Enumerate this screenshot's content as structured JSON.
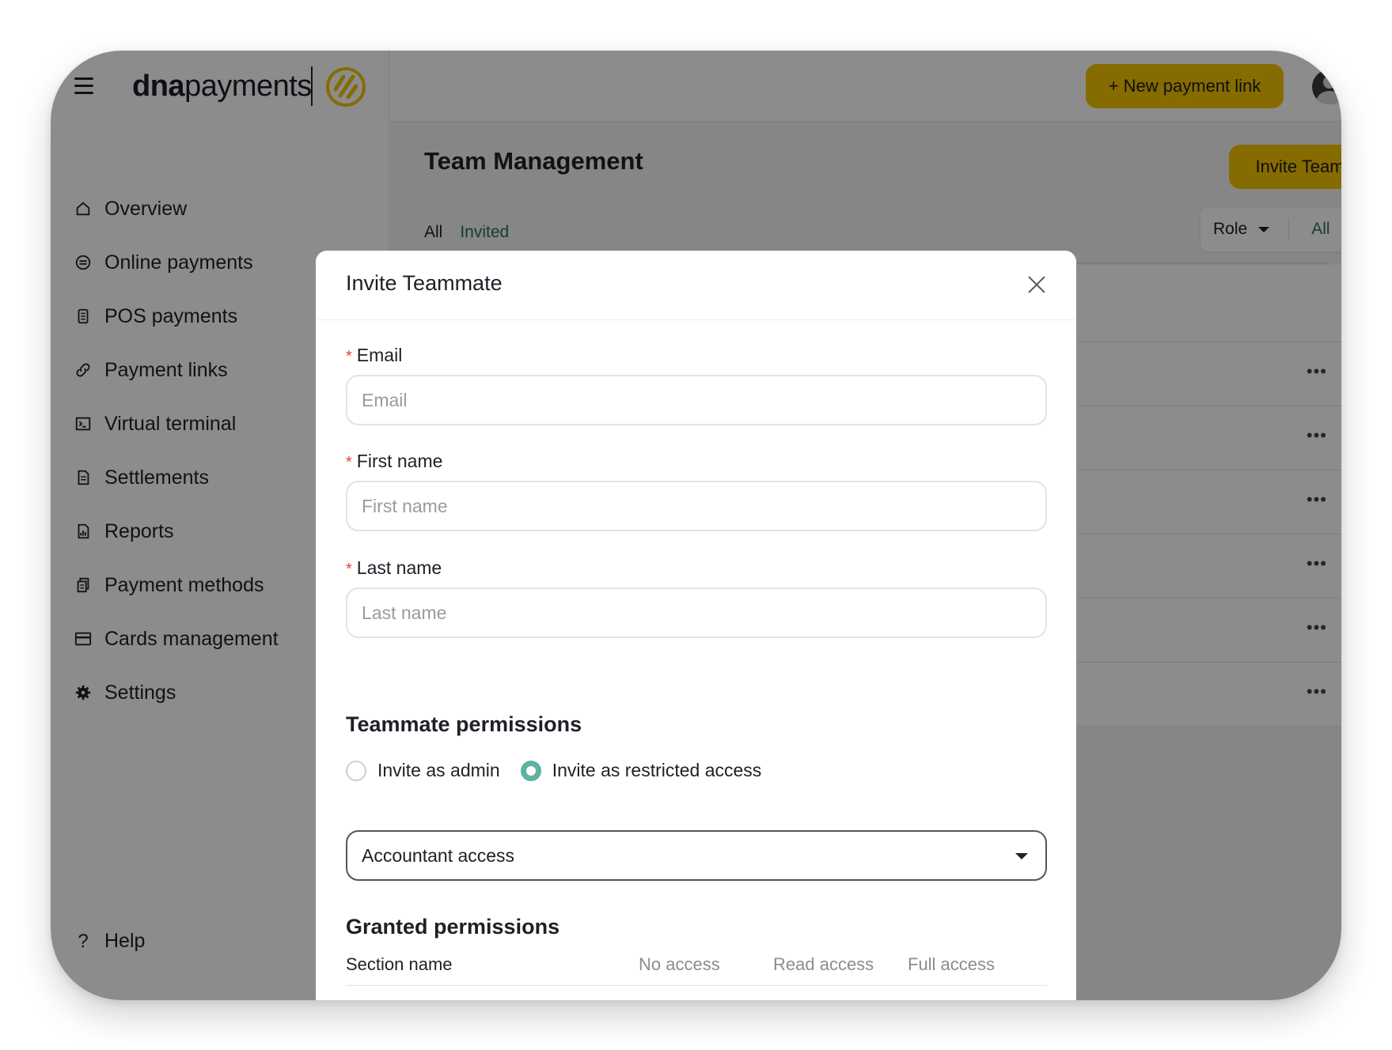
{
  "brand": {
    "bold": "dna",
    "light": "payments",
    "accent": "#f5c400"
  },
  "sidebar": {
    "items": [
      {
        "label": "Overview",
        "icon": "home-icon"
      },
      {
        "label": "Online payments",
        "icon": "online-payments-icon"
      },
      {
        "label": "POS payments",
        "icon": "pos-terminal-icon"
      },
      {
        "label": "Payment links",
        "icon": "link-icon"
      },
      {
        "label": "Virtual terminal",
        "icon": "terminal-icon"
      },
      {
        "label": "Settlements",
        "icon": "document-icon"
      },
      {
        "label": "Reports",
        "icon": "report-icon"
      },
      {
        "label": "Payment methods",
        "icon": "payment-methods-icon"
      },
      {
        "label": "Cards management",
        "icon": "card-icon"
      },
      {
        "label": "Settings",
        "icon": "gear-icon"
      }
    ],
    "help": {
      "label": "Help",
      "icon": "help-icon"
    }
  },
  "topbar": {
    "new_link_label": "+ New payment link"
  },
  "page": {
    "title": "Team Management",
    "invite_label": "Invite Teammate",
    "tabs": [
      "All",
      "Invited"
    ],
    "filter": {
      "role_label": "Role",
      "value": "All"
    }
  },
  "modal": {
    "title": "Invite Teammate",
    "fields": {
      "email": {
        "label": "Email",
        "placeholder": "Email",
        "value": ""
      },
      "first_name": {
        "label": "First name",
        "placeholder": "First name",
        "value": ""
      },
      "last_name": {
        "label": "Last name",
        "placeholder": "Last name",
        "value": ""
      }
    },
    "required_mark": "*",
    "permissions_title": "Teammate permissions",
    "radio": {
      "admin": "Invite as admin",
      "restricted": "Invite as restricted access",
      "selected": "restricted"
    },
    "access_select": {
      "value": "Accountant access"
    },
    "granted": {
      "title": "Granted permissions",
      "columns": [
        "Section name",
        "No access",
        "Read access",
        "Full access"
      ]
    }
  },
  "colors": {
    "accent_yellow": "#f5c400",
    "teal": "#5fb3a0",
    "required_red": "#e0443e",
    "link_green": "#2c6e54"
  }
}
